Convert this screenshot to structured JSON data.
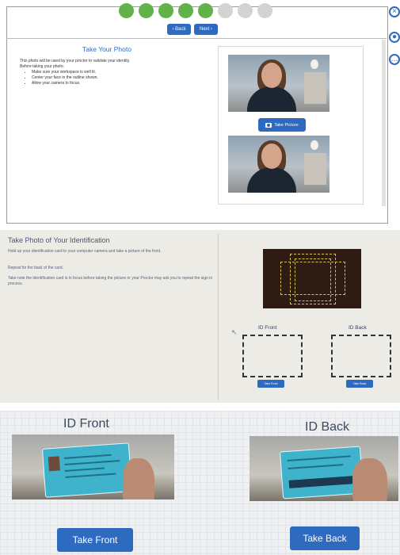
{
  "panel1": {
    "steps": {
      "done": 5,
      "total": 8
    },
    "nav": {
      "back_label": "‹ Back",
      "next_label": "Next ›"
    },
    "title": "Take Your Photo",
    "intro": "This photo will be used by your proctor to validate your identity.",
    "before_label": "Before taking your photo:",
    "bullets": [
      "Make sure your workspace is well lit.",
      "Center your face in the outline shown.",
      "Allow your camera to focus."
    ],
    "take_picture_label": "Take Picture",
    "side_icons": [
      "close-icon",
      "help-icon",
      "chat-icon"
    ]
  },
  "panel2": {
    "heading": "Take Photo of Your Identification",
    "text1": "Hold up your identification card to your computer camera and take a picture of the front.",
    "text2": "Repeat for the back of the card.",
    "text3": "Take note the identification card is in focus before taking the picture or your Proctor may ask you to repeat the sign in process.",
    "front_caption": "ID Front",
    "back_caption": "ID Back",
    "take_front_label": "Take Front",
    "take_back_label": "Take Back"
  },
  "panel3": {
    "front_caption": "ID Front",
    "back_caption": "ID Back",
    "take_front_label": "Take Front",
    "take_back_label": "Take Back"
  },
  "colors": {
    "accent": "#2e6bc0",
    "step_done": "#63b249",
    "step_todo": "#d3d3d3"
  }
}
